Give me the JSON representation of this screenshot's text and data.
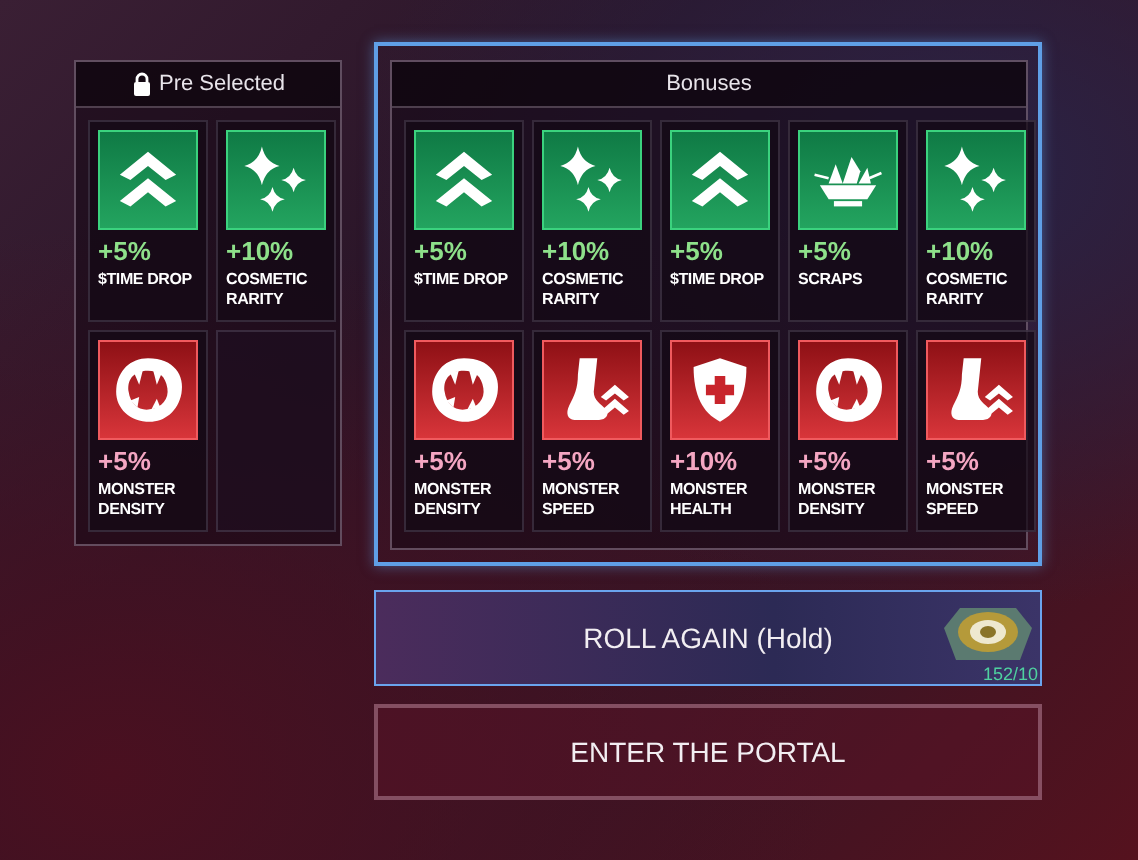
{
  "pre_selected": {
    "title": "Pre Selected",
    "tiles": [
      {
        "kind": "time-drop",
        "value": "+5%",
        "label": "$TIME DROP"
      },
      {
        "kind": "cosmetic-rarity",
        "value": "+10%",
        "label": "COSMETIC RARITY"
      },
      {
        "kind": "monster-density",
        "value": "+5%",
        "label": "MONSTER DENSITY"
      },
      {
        "kind": "empty"
      }
    ]
  },
  "bonuses": {
    "title": "Bonuses",
    "tiles": [
      {
        "kind": "time-drop",
        "value": "+5%",
        "label": "$TIME DROP"
      },
      {
        "kind": "cosmetic-rarity",
        "value": "+10%",
        "label": "COSMETIC RARITY"
      },
      {
        "kind": "time-drop",
        "value": "+5%",
        "label": "$TIME DROP"
      },
      {
        "kind": "scraps",
        "value": "+5%",
        "label": "SCRAPS"
      },
      {
        "kind": "cosmetic-rarity",
        "value": "+10%",
        "label": "COSMETIC RARITY"
      },
      {
        "kind": "monster-density",
        "value": "+5%",
        "label": "MONSTER DENSITY"
      },
      {
        "kind": "monster-speed",
        "value": "+5%",
        "label": "MONSTER SPEED"
      },
      {
        "kind": "monster-health",
        "value": "+10%",
        "label": "MONSTER HEALTH"
      },
      {
        "kind": "monster-density",
        "value": "+5%",
        "label": "MONSTER DENSITY"
      },
      {
        "kind": "monster-speed",
        "value": "+5%",
        "label": "MONSTER SPEED"
      }
    ]
  },
  "roll_button": {
    "label": "ROLL AGAIN (Hold)",
    "cost": "152/10"
  },
  "portal_button": {
    "label": "ENTER THE PORTAL"
  }
}
